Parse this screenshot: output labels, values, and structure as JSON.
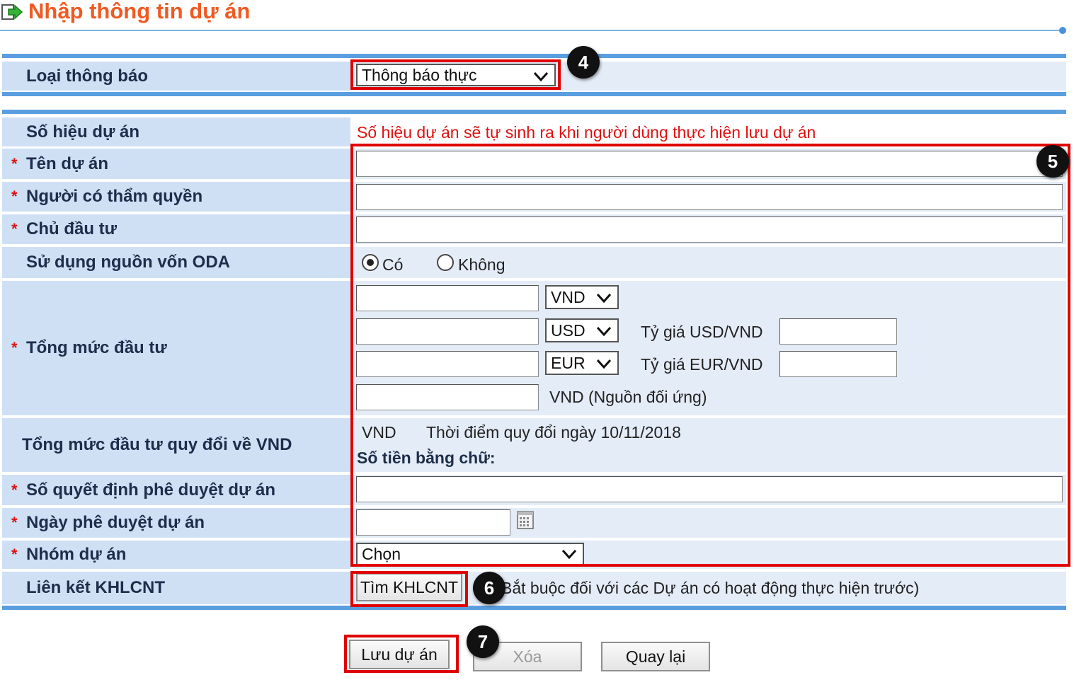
{
  "header": {
    "title": "Nhập thông tin dự án"
  },
  "notice_type": {
    "label": "Loại thông báo",
    "selected": "Thông báo thực"
  },
  "project_number": {
    "label": "Số hiệu dự án",
    "note": "Số hiệu dự án sẽ tự sinh ra khi người dùng thực hiện lưu dự án"
  },
  "project_name": {
    "label": "Tên dự án",
    "value": ""
  },
  "authority": {
    "label": "Người có thẩm quyền",
    "value": ""
  },
  "investor": {
    "label": "Chủ đầu tư",
    "value": ""
  },
  "oda": {
    "label": "Sử dụng nguồn vốn ODA",
    "options": [
      "Có",
      "Không"
    ],
    "selected": "Có"
  },
  "total_investment": {
    "label": "Tổng mức đầu tư",
    "currencies": [
      "VND",
      "USD",
      "EUR"
    ],
    "rate_usd_label": "Tỷ giá USD/VND",
    "rate_eur_label": "Tỷ giá EUR/VND",
    "counterpart_label": "VND (Nguồn đối ứng)"
  },
  "converted_total": {
    "label": "Tổng mức đầu tư quy đổi về VND",
    "unit": "VND",
    "conversion_note": "Thời điểm quy đổi ngày 10/11/2018",
    "words_label": "Số tiền bằng chữ:"
  },
  "decision_number": {
    "label": "Số quyết định phê duyệt dự án",
    "value": ""
  },
  "approval_date": {
    "label": "Ngày phê duyệt dự án",
    "value": ""
  },
  "project_group": {
    "label": "Nhóm dự án",
    "selected": "Chọn"
  },
  "khlcnt_link": {
    "label": "Liên kết KHLCNT",
    "button": "Tìm KHLCNT",
    "note": "Bắt buộc đối với các Dự án có hoạt động thực hiện trước)"
  },
  "required_mark": "*",
  "actions": {
    "save": "Lưu dự án",
    "delete": "Xóa",
    "back": "Quay lại"
  },
  "annotations": [
    "4",
    "5",
    "6",
    "7"
  ],
  "colors": {
    "title": "#f05a22",
    "highlight": "#e00000",
    "label_bg": "#cfe0f5",
    "bar": "#5a9ee0"
  }
}
